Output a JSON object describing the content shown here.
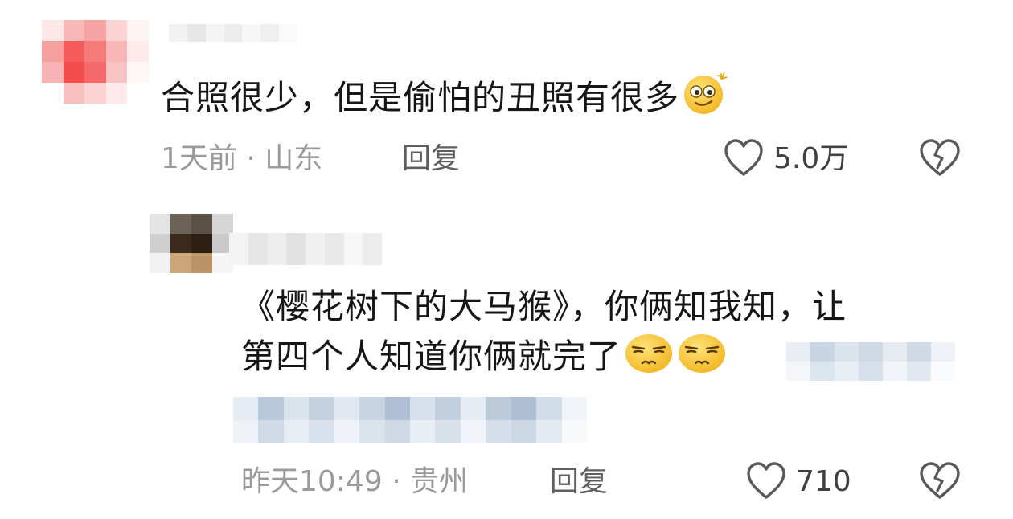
{
  "comments": [
    {
      "text": "合照很少，但是偷怕的丑照有很多",
      "emoji": "dizzy-face-emoji",
      "meta": "1天前 · 山东",
      "reply_label": "回复",
      "likes": "5.0万"
    },
    {
      "text_line1": "《樱花树下的大马猴》，你俩知我知，让",
      "text_line2": "第四个人知道你俩就完了",
      "emoji": "smirk-emoji",
      "meta": "昨天10:49 · 贵州",
      "reply_label": "回复",
      "likes": "710"
    }
  ],
  "icons": {
    "like": "heart-outline-icon",
    "dislike": "broken-heart-icon"
  },
  "colors": {
    "text": "#161616",
    "meta": "#9a9a9a",
    "reply": "#5f5f5f",
    "icon": "#595959",
    "emoji_face": "#f7c531"
  }
}
